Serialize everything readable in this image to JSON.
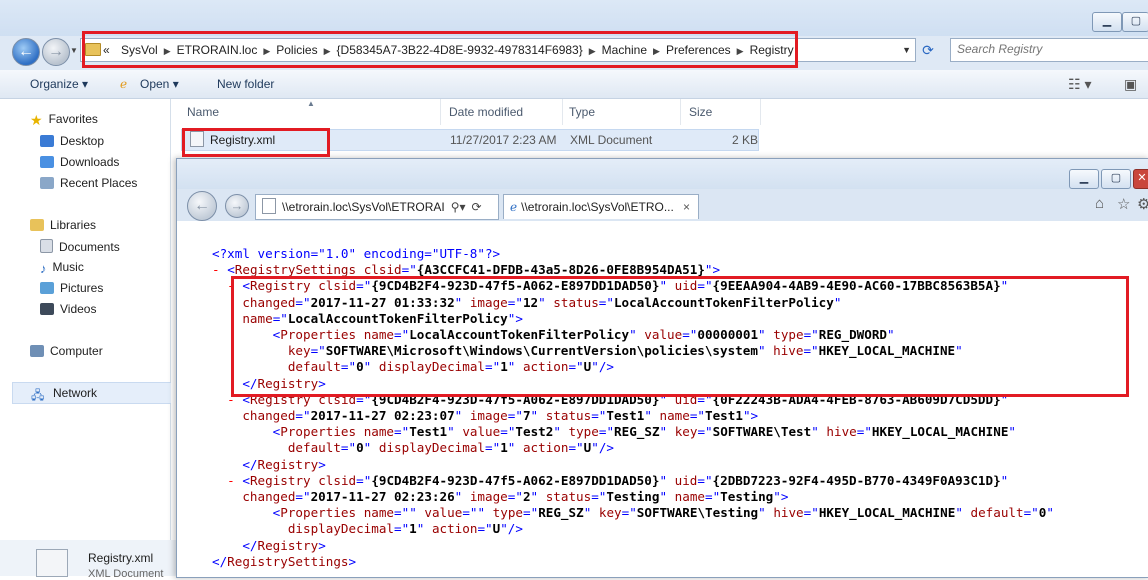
{
  "explorer": {
    "breadcrumb": [
      "SysVol",
      "ETRORAIN.loc",
      "Policies",
      "{D58345A7-3B22-4D8E-9932-4978314F6983}",
      "Machine",
      "Preferences",
      "Registry"
    ],
    "breadcrumb_prefix": "«",
    "search_placeholder": "Search Registry",
    "toolbar": {
      "organize": "Organize ▾",
      "open": "Open ▾",
      "new_folder": "New folder"
    },
    "nav": {
      "favorites": "Favorites",
      "desktop": "Desktop",
      "downloads": "Downloads",
      "recent": "Recent Places",
      "libraries": "Libraries",
      "documents": "Documents",
      "music": "Music",
      "pictures": "Pictures",
      "videos": "Videos",
      "computer": "Computer",
      "network": "Network"
    },
    "columns": {
      "name": "Name",
      "date": "Date modified",
      "type": "Type",
      "size": "Size"
    },
    "file": {
      "name": "Registry.xml",
      "date": "11/27/2017 2:23 AM",
      "type": "XML Document",
      "size": "2 KB"
    },
    "details": {
      "name": "Registry.xml",
      "type": "XML Document"
    }
  },
  "ie": {
    "address": "\\\\etrorain.loc\\SysVol\\ETRORAI",
    "tab_title": "\\\\etrorain.loc\\SysVol\\ETRO...",
    "tab_close": "×",
    "xml": {
      "decl": "<?xml version=\"1.0\" encoding=\"UTF-8\"?>",
      "root_clsid": "{A3CCFC41-DFDB-43a5-8D26-0FE8B954DA51}",
      "registry_clsid": "{9CD4B2F4-923D-47f5-A062-E897DD1DAD50}",
      "entries": [
        {
          "uid": "{9EEAA904-4AB9-4E90-AC60-17BBC8563B5A}",
          "changed": "2017-11-27 01:33:32",
          "image": "12",
          "status": "LocalAccountTokenFilterPolicy",
          "name": "LocalAccountTokenFilterPolicy",
          "prop_name": "LocalAccountTokenFilterPolicy",
          "prop_value": "00000001",
          "prop_type": "REG_DWORD",
          "prop_key": "SOFTWARE\\Microsoft\\Windows\\CurrentVersion\\policies\\system",
          "prop_hive": "HKEY_LOCAL_MACHINE",
          "prop_default": "0",
          "prop_displayDecimal": "1",
          "prop_action": "U"
        },
        {
          "uid": "{0F22243B-ADA4-4FEB-8763-AB609D7CD5DD}",
          "changed": "2017-11-27 02:23:07",
          "image": "7",
          "status": "Test1",
          "name": "Test1",
          "prop_name": "Test1",
          "prop_value": "Test2",
          "prop_type": "REG_SZ",
          "prop_key": "SOFTWARE\\Test",
          "prop_hive": "HKEY_LOCAL_MACHINE",
          "prop_default": "0",
          "prop_displayDecimal": "1",
          "prop_action": "U"
        },
        {
          "uid": "{2DBD7223-92F4-495D-B770-4349F0A93C1D}",
          "changed": "2017-11-27 02:23:26",
          "image": "2",
          "status": "Testing",
          "name": "Testing",
          "prop_name": "",
          "prop_value": "",
          "prop_type": "REG_SZ",
          "prop_key": "SOFTWARE\\Testing",
          "prop_hive": "HKEY_LOCAL_MACHINE",
          "prop_default": "0",
          "prop_displayDecimal": "1",
          "prop_action": "U"
        }
      ]
    }
  },
  "colors": {
    "highlight": "#e21b23",
    "xml_tag": "#990000",
    "xml_value": "#0000ff"
  }
}
